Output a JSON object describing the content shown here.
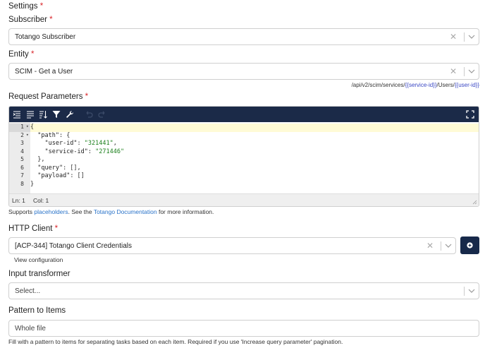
{
  "settings": {
    "title": "Settings",
    "required": "*"
  },
  "subscriber": {
    "label": "Subscriber",
    "required": "*",
    "value": "Totango Subscriber"
  },
  "entity": {
    "label": "Entity",
    "required": "*",
    "value": "SCIM - Get a User"
  },
  "endpoint": {
    "p1": "/api/v2/scim/services/",
    "p2": "{{service-id}}",
    "p3": "/Users/",
    "p4": "{{user-id}}"
  },
  "request_params": {
    "label": "Request Parameters",
    "required": "*",
    "lines": [
      {
        "num": "1",
        "fold": "▾"
      },
      {
        "num": "2",
        "fold": "▾"
      },
      {
        "num": "3",
        "fold": ""
      },
      {
        "num": "4",
        "fold": ""
      },
      {
        "num": "5",
        "fold": ""
      },
      {
        "num": "6",
        "fold": ""
      },
      {
        "num": "7",
        "fold": ""
      },
      {
        "num": "8",
        "fold": ""
      }
    ],
    "code": {
      "l1": "{",
      "l2a": "  ",
      "l2k": "\"path\"",
      "l2b": ": {",
      "l3a": "    ",
      "l3k": "\"user-id\"",
      "l3b": ": ",
      "l3v": "\"321441\"",
      "l3c": ",",
      "l4a": "    ",
      "l4k": "\"service-id\"",
      "l4b": ": ",
      "l4v": "\"271446\"",
      "l5": "  },",
      "l6a": "  ",
      "l6k": "\"query\"",
      "l6b": ": [],",
      "l7a": "  ",
      "l7k": "\"payload\"",
      "l7b": ": []",
      "l8": "}"
    },
    "status_ln": "Ln: 1",
    "status_col": "Col: 1"
  },
  "help": {
    "pre": "Supports ",
    "link1": "placeholders",
    "mid": ". See the ",
    "link2": "Totango Documentation",
    "post": " for more information."
  },
  "http_client": {
    "label": "HTTP Client",
    "required": "*",
    "value": "[ACP-344] Totango Client Credentials",
    "view_config": "View configuration",
    "add_icon": "plus-circle-icon"
  },
  "input_transformer": {
    "label": "Input transformer",
    "placeholder": "Select..."
  },
  "pattern": {
    "label": "Pattern to Items",
    "placeholder": "Whole file",
    "hint": "Fill with a pattern to items for separating tasks based on each item. Required if you use 'Increase query parameter' pagination."
  },
  "colors": {
    "toolbar_bg": "#1b2a48",
    "link": "#2a73c9",
    "required": "#d9262b",
    "string": "#1a7f1a"
  }
}
